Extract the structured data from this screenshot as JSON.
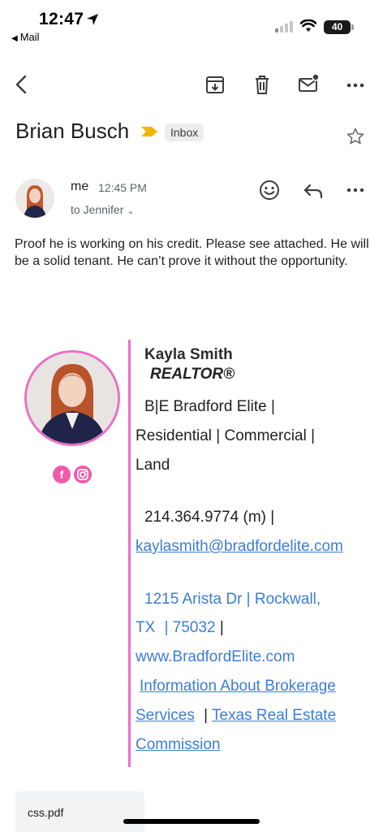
{
  "status_bar": {
    "time": "12:47",
    "back_app": "Mail",
    "battery": "40"
  },
  "toolbar": {
    "icons": [
      "back-arrow-icon",
      "archive-icon",
      "trash-icon",
      "mark-unread-icon",
      "more-icon"
    ]
  },
  "email": {
    "subject": "Brian Busch",
    "label": "Inbox",
    "sender": "me",
    "time": "12:45 PM",
    "to": "to Jennifer",
    "body": "Proof he is working on his credit. Please see attached. He will be a solid tenant. He can’t prove it without the opportunity."
  },
  "signature": {
    "name": "Kayla Smith",
    "title": "REALTOR®",
    "company_line1": "B|E Bradford Elite |",
    "company_line2": "Residential | Commercial |",
    "company_line3": "Land",
    "phone": "214.364.9774 (m) |",
    "email": "kaylasmith@bradfordelite.com",
    "address_line1": "1215 Arista Dr | Rockwall,",
    "address_state": "TX",
    "address_zip": "| 75032",
    "address_sep": "|",
    "website": "www.BradfordElite.com",
    "link1_line1": "Information About Brokerage",
    "link1_line2": "Services",
    "link_sep": "|",
    "link2_line1": "Texas Real Estate",
    "link2_line2": "Commission",
    "social": [
      "facebook-icon",
      "instagram-icon"
    ],
    "colors": {
      "accent": "#e870c8",
      "link": "#3b7dd8",
      "social": "#ef5ba9"
    }
  },
  "attachment": {
    "filename": "css.pdf"
  }
}
